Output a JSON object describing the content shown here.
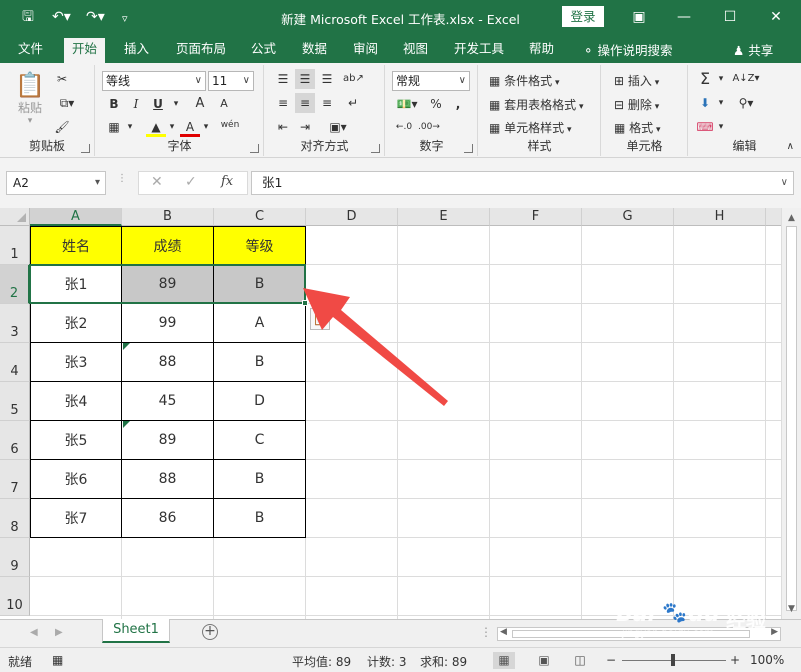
{
  "titlebar": {
    "title": "新建 Microsoft Excel 工作表.xlsx  -  Excel",
    "login": "登录"
  },
  "tabs": [
    "文件",
    "开始",
    "插入",
    "页面布局",
    "公式",
    "数据",
    "审阅",
    "视图",
    "开发工具",
    "帮助"
  ],
  "active_tab": "开始",
  "tell_me": "操作说明搜索",
  "share": "共享",
  "ribbon": {
    "clipboard": {
      "label": "剪贴板",
      "paste": "粘贴"
    },
    "font": {
      "label": "字体",
      "name": "等线",
      "size": "11",
      "bold": "B",
      "italic": "I",
      "underline": "U",
      "grow": "A",
      "shrink": "A",
      "wen": "wén"
    },
    "alignment": {
      "label": "对齐方式"
    },
    "number": {
      "label": "数字",
      "format": "常规",
      "percent": "%",
      "comma": ","
    },
    "styles": {
      "label": "样式",
      "cond": "条件格式",
      "table": "套用表格格式",
      "cell": "单元格样式"
    },
    "cells": {
      "label": "单元格",
      "insert": "插入",
      "delete": "删除",
      "format": "格式"
    },
    "editing": {
      "label": "编辑",
      "sum": "Σ"
    }
  },
  "formula_bar": {
    "name_box": "A2",
    "fx": "fx",
    "value": "张1"
  },
  "grid": {
    "columns": [
      "A",
      "B",
      "C",
      "D",
      "E",
      "F",
      "G",
      "H"
    ],
    "rows": [
      "1",
      "2",
      "3",
      "4",
      "5",
      "6",
      "7",
      "8",
      "9",
      "10"
    ],
    "header": [
      "姓名",
      "成绩",
      "等级"
    ],
    "data": [
      [
        "张1",
        "89",
        "B"
      ],
      [
        "张2",
        "99",
        "A"
      ],
      [
        "张3",
        "88",
        "B"
      ],
      [
        "张4",
        "45",
        "D"
      ],
      [
        "张5",
        "89",
        "C"
      ],
      [
        "张6",
        "88",
        "B"
      ],
      [
        "张7",
        "86",
        "B"
      ]
    ]
  },
  "sheet_tab": "Sheet1",
  "status": {
    "ready": "就绪",
    "average": "平均值: 89",
    "count": "计数: 3",
    "sum": "求和: 89",
    "zoom": "100%"
  },
  "colors": {
    "excel_green": "#217346",
    "header_fill": "#ffff00",
    "highlight_fill": "#c8c8c8",
    "arrow": "#f04a45"
  },
  "watermark": {
    "logo": "Bai",
    "paw": "du",
    "suffix": "经验",
    "url": "jingyan.baidu.com"
  }
}
